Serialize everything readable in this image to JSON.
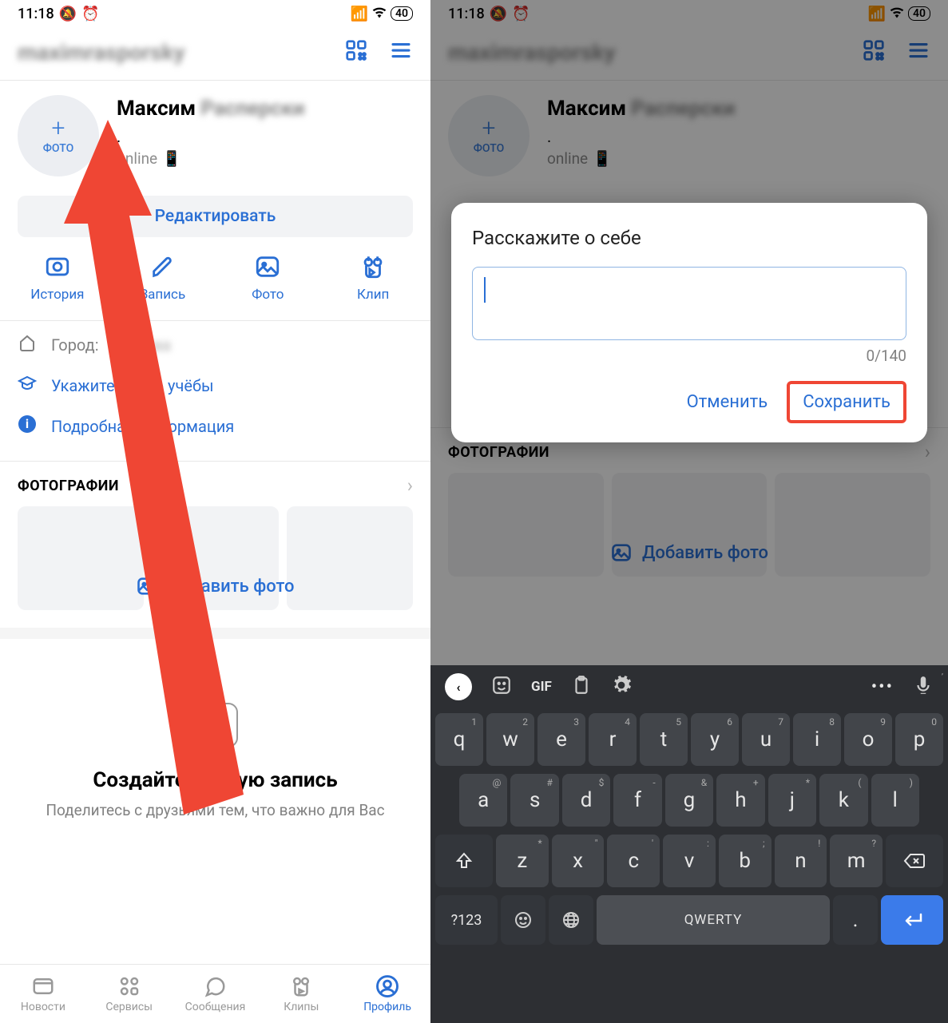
{
  "status": {
    "time": "11:18",
    "battery": "40"
  },
  "header_name": "maximrasporsky",
  "profile": {
    "first_name": "Максим",
    "last_name": "Расперски",
    "photo_label": "ФОТО",
    "online": "online"
  },
  "edit_btn": "Редактировать",
  "quick_actions": [
    {
      "label": "История"
    },
    {
      "label": "Запись"
    },
    {
      "label": "Фото"
    },
    {
      "label": "Клип"
    }
  ],
  "info": {
    "city_label": "Город:",
    "study": "Укажите место учёбы",
    "more": "Подробная информация"
  },
  "photos": {
    "section": "ФОТОГРАФИИ",
    "add": "Добавить фото"
  },
  "compose": {
    "title": "Создайте первую запись",
    "sub": "Поделитесь с друзьями тем, что важно для Вас"
  },
  "tabs": [
    {
      "label": "Новости"
    },
    {
      "label": "Сервисы"
    },
    {
      "label": "Сообщения"
    },
    {
      "label": "Клипы"
    },
    {
      "label": "Профиль"
    }
  ],
  "dialog": {
    "title": "Расскажите о себе",
    "count": "0/140",
    "cancel": "Отменить",
    "save": "Сохранить"
  },
  "keyboard": {
    "row1": [
      "q",
      "w",
      "e",
      "r",
      "t",
      "y",
      "u",
      "i",
      "o",
      "p"
    ],
    "row1_sup": [
      "1",
      "2",
      "3",
      "4",
      "5",
      "6",
      "7",
      "8",
      "9",
      "0"
    ],
    "row2": [
      "a",
      "s",
      "d",
      "f",
      "g",
      "h",
      "j",
      "k",
      "l"
    ],
    "row2_sup": [
      "@",
      "#",
      "$",
      "-",
      "&",
      "+",
      "*",
      "(",
      ")"
    ],
    "row3": [
      "z",
      "x",
      "c",
      "v",
      "b",
      "n",
      "m"
    ],
    "row3_sup": [
      "*",
      "\"",
      "'",
      ":",
      ";",
      "!",
      "?"
    ],
    "space": "QWERTY",
    "num": "?123",
    "gif": "GIF"
  }
}
